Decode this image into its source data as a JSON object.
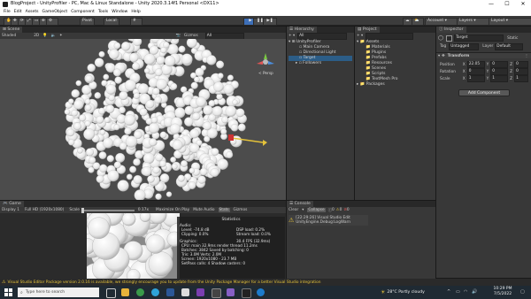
{
  "window": {
    "title": "BlogProject - UnityProfiler - PC, Mac & Linux Standalone - Unity 2020.3.14f1 Personal <DX11>",
    "controls": [
      "—",
      "☐",
      "✕"
    ]
  },
  "menu": [
    "File",
    "Edit",
    "Assets",
    "GameObject",
    "Component",
    "Tools",
    "Window",
    "Help"
  ],
  "toolbar": {
    "pivot": "Pivot",
    "local": "Local",
    "account": "Account",
    "layers": "Layers",
    "layout": "Layout"
  },
  "scene": {
    "tab": "Scene",
    "shading": "Shaded",
    "twod": "2D",
    "gizmos": "Gizmos",
    "search_placeholder": "All",
    "persp": "< Persp"
  },
  "hierarchy": {
    "tab": "Hierarchy",
    "search_placeholder": "All",
    "scene_name": "UnityProfiler",
    "items": [
      "Main Camera",
      "Directional Light",
      "Target",
      "Followers"
    ]
  },
  "project": {
    "tab": "Project",
    "assets": "Assets",
    "folders": [
      "Materials",
      "Plugins",
      "Prefabs",
      "Resources",
      "Scenes",
      "Scripts",
      "TextMesh Pro"
    ],
    "packages": "Packages"
  },
  "inspector": {
    "tab": "Inspector",
    "object_name": "Target",
    "static": "Static",
    "tag_label": "Tag",
    "tag_value": "Untagged",
    "layer_label": "Layer",
    "layer_value": "Default",
    "component": "Transform",
    "rows": [
      {
        "label": "Position",
        "x": "22.05",
        "y": "0",
        "z": "0"
      },
      {
        "label": "Rotation",
        "x": "0",
        "y": "0",
        "z": "0"
      },
      {
        "label": "Scale",
        "x": "1",
        "y": "1",
        "z": "1"
      }
    ],
    "add_component": "Add Component"
  },
  "game": {
    "tab": "Game",
    "display": "Display 1",
    "resolution": "Full HD (1920x1080)",
    "scale_label": "Scale",
    "scale_value": "0.17x",
    "maximize": "Maximize On Play",
    "mute": "Mute Audio",
    "stats": "Stats",
    "gizmos": "Gizmos"
  },
  "stats": {
    "title": "Statistics",
    "audio_header": "Audio:",
    "audio_left": [
      "Level: -74.8 dB",
      "Clipping: 0.0%"
    ],
    "audio_right": [
      "DSP load: 0.2%",
      "Stream load: 0.0%"
    ],
    "graphics_header": "Graphics:",
    "fps": "30.4 FPS (32.9ms)",
    "lines": [
      "CPU: main 32.9ms  render thread 11.2ms",
      "Batches: 3842  Saved by batching: 0",
      "Tris: 3.0M   Verts: 2.0M",
      "Screen: 1920x1080 - 23.7 MB",
      "SetPass calls: 4    Shadow casters: 0"
    ]
  },
  "console": {
    "tab": "Console",
    "clear": "Clear",
    "collapse": "Collapse",
    "count_warn": "0",
    "count_info": "0",
    "count_err": "0",
    "entry_time": "[22:29:26] Visual Studio Edit",
    "entry_sub": "UnityEngine.Debug:LogWarn"
  },
  "statusbar": {
    "message": "Visual Studio Editor Package version 2.0.16 is available, we strongly encourage you to update from the Unity Package Manager for a better Visual Studio integration"
  },
  "taskbar": {
    "search_placeholder": "Type here to search",
    "weather": "28°C  Partly cloudy",
    "time": "10:29 PM",
    "date": "7/5/2022"
  },
  "colors": {
    "accent": "#4b8fe0",
    "play_active": "#3d6fb8",
    "warning": "#e4c23a",
    "statusbar_text": "#e4c23a",
    "taskbar": "#1f2a33"
  }
}
